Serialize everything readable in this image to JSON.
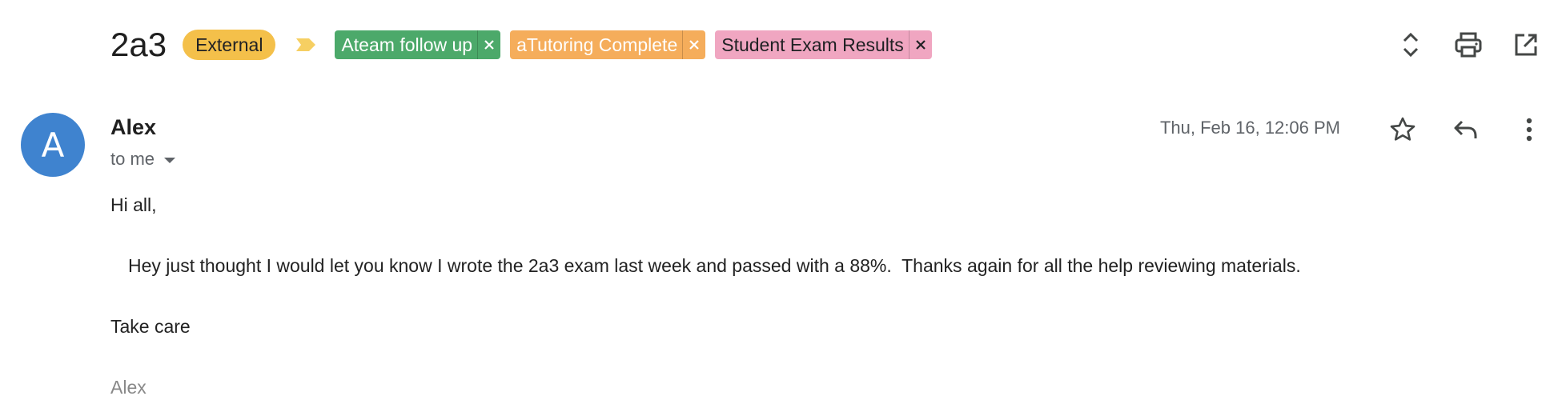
{
  "thread": {
    "subject": "2a3",
    "external_badge": "External",
    "labels": [
      {
        "text": "Ateam follow up",
        "color": "#4ca96a"
      },
      {
        "text": "aTutoring Complete",
        "color": "#f5ad5b"
      },
      {
        "text": "Student Exam Results",
        "color": "#f0a6c1"
      }
    ],
    "icons": {
      "importance": "importance-marker-icon",
      "expand": "expand-all-icon",
      "print": "print-icon",
      "popout": "open-in-new-window-icon"
    }
  },
  "message": {
    "avatar_letter": "A",
    "avatar_color": "#3f83cf",
    "sender": "Alex",
    "recipient": "to me",
    "date": "Thu, Feb 16, 12:06 PM",
    "icons": {
      "star": "star-icon",
      "reply": "reply-icon",
      "more": "more-vert-icon"
    },
    "body": {
      "greeting": "Hi all,",
      "main": "Hey just thought I would let you know I wrote the 2a3 exam last week and passed with a 88%.  Thanks again for all the help reviewing materials.",
      "closing": "Take care",
      "signature": "Alex"
    }
  }
}
